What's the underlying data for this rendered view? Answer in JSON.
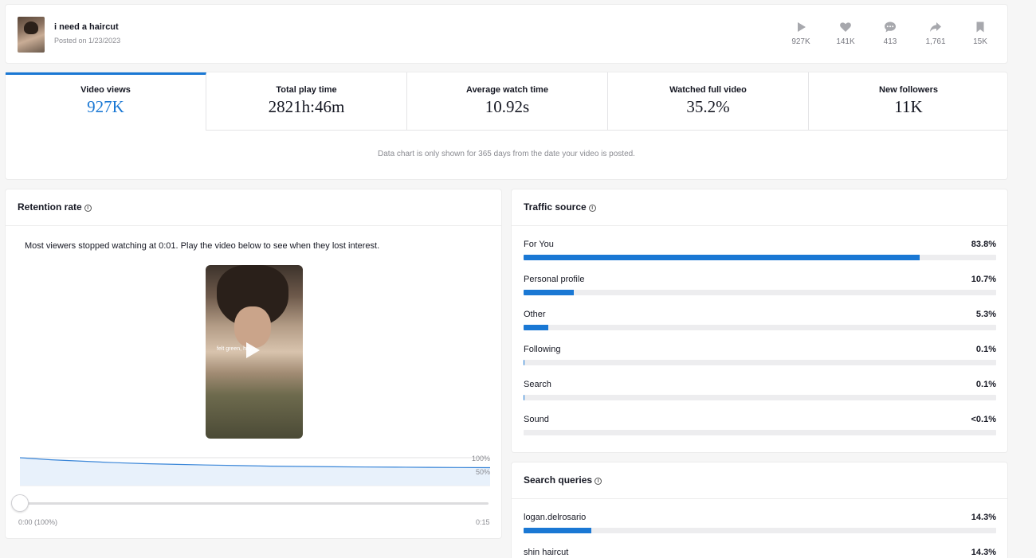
{
  "video": {
    "title": "i need a haircut",
    "posted": "Posted on 1/23/2023",
    "stats": [
      {
        "icon": "play-icon",
        "value": "927K"
      },
      {
        "icon": "heart-icon",
        "value": "141K"
      },
      {
        "icon": "comment-icon",
        "value": "413"
      },
      {
        "icon": "share-icon",
        "value": "1,761"
      },
      {
        "icon": "bookmark-icon",
        "value": "15K"
      }
    ]
  },
  "metrics": {
    "tabs": [
      {
        "label": "Video views",
        "value": "927K",
        "active": true
      },
      {
        "label": "Total play time",
        "value": "2821h:46m"
      },
      {
        "label": "Average watch time",
        "value": "10.92s"
      },
      {
        "label": "Watched full video",
        "value": "35.2%"
      },
      {
        "label": "New followers",
        "value": "11K"
      }
    ],
    "note": "Data chart is only shown for 365 days from the date your video is posted."
  },
  "retention": {
    "title": "Retention rate",
    "message": "Most viewers stopped watching at 0:01. Play the video below to see when they lost interest.",
    "video_caption": "felt green, hey",
    "label_100": "100%",
    "label_50": "50%",
    "time_start": "0:00 (100%)",
    "time_end": "0:15",
    "curve_percent": [
      100,
      94,
      90,
      86,
      83,
      81,
      79,
      77.5,
      76,
      75,
      74,
      73.5,
      73,
      72.5,
      72,
      71.5
    ],
    "colors": {
      "line": "#3a86d8",
      "fill": "#e8f1fb"
    }
  },
  "traffic": {
    "title": "Traffic source",
    "rows": [
      {
        "name": "For You",
        "pct": "83.8%",
        "fraction": 0.838
      },
      {
        "name": "Personal profile",
        "pct": "10.7%",
        "fraction": 0.107
      },
      {
        "name": "Other",
        "pct": "5.3%",
        "fraction": 0.053
      },
      {
        "name": "Following",
        "pct": "0.1%",
        "fraction": 0.001
      },
      {
        "name": "Search",
        "pct": "0.1%",
        "fraction": 0.001
      },
      {
        "name": "Sound",
        "pct": "<0.1%",
        "fraction": 0
      }
    ]
  },
  "search": {
    "title": "Search queries",
    "rows": [
      {
        "name": "logan.delrosario",
        "pct": "14.3%",
        "fraction": 0.143
      },
      {
        "name": "shin haircut",
        "pct": "14.3%",
        "fraction": 0.143
      }
    ]
  },
  "colors": {
    "accent": "#1a78d4"
  }
}
